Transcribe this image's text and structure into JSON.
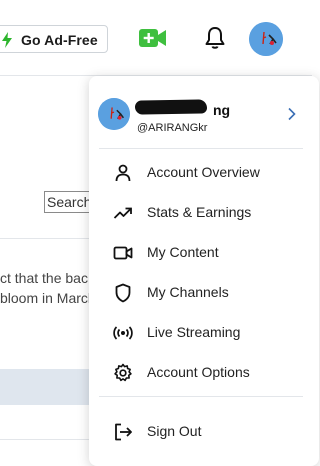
{
  "topbar": {
    "ad_free_label": "Go Ad-Free",
    "colors": {
      "accent_green": "#3fbf3f",
      "bolt_green": "#2db52d"
    },
    "icons": [
      "bolt-icon",
      "video-add-icon",
      "bell-icon",
      "avatar"
    ]
  },
  "background": {
    "search_text": "Search",
    "line1": "ct that the bac",
    "line2": "bloom in March"
  },
  "menu": {
    "profile": {
      "name_suffix": "ng",
      "handle": "@ARIRANGkr"
    },
    "items": [
      {
        "label": "Account Overview",
        "icon": "user-icon"
      },
      {
        "label": "Stats & Earnings",
        "icon": "trending-up-icon"
      },
      {
        "label": "My Content",
        "icon": "video-camera-icon"
      },
      {
        "label": "My Channels",
        "icon": "shield-icon"
      },
      {
        "label": "Live Streaming",
        "icon": "broadcast-icon"
      },
      {
        "label": "Account Options",
        "icon": "gear-icon"
      }
    ],
    "sign_out": {
      "label": "Sign Out",
      "icon": "sign-out-icon"
    }
  }
}
